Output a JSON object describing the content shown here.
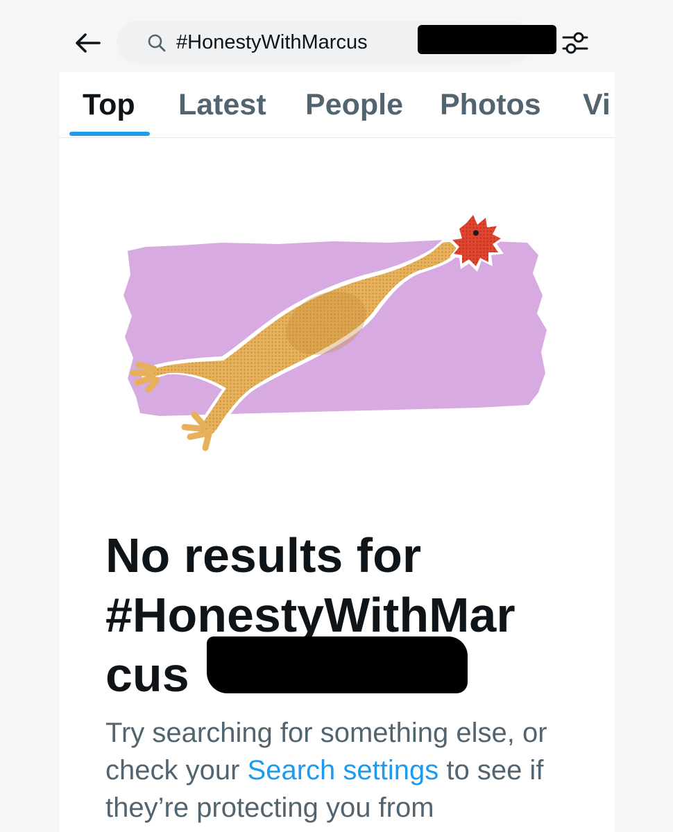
{
  "search": {
    "query": "#HonestyWithMarcus",
    "icon": "search-icon"
  },
  "topbar": {
    "back_icon": "back-arrow-icon",
    "filter_icon": "filter-sliders-icon"
  },
  "tabs": [
    {
      "label": "Top",
      "active": true
    },
    {
      "label": "Latest",
      "active": false
    },
    {
      "label": "People",
      "active": false
    },
    {
      "label": "Photos",
      "active": false
    },
    {
      "label": "Vi",
      "active": false
    }
  ],
  "empty_state": {
    "illustration": "rubber-chicken-illustration",
    "title_line1": "No results for",
    "title_line2": "#HonestyWithMar",
    "title_line3": "cus",
    "desc_before": "Try searching for something else, or check your ",
    "desc_link": "Search settings",
    "desc_after": " to see if they’re protecting you from"
  },
  "colors": {
    "accent": "#1d9bf0",
    "text_primary": "#0f1419",
    "text_secondary": "#536471",
    "illustration_background": "#d7abe1",
    "chicken_body": "#e6b15a",
    "chicken_comb": "#e0452f"
  }
}
